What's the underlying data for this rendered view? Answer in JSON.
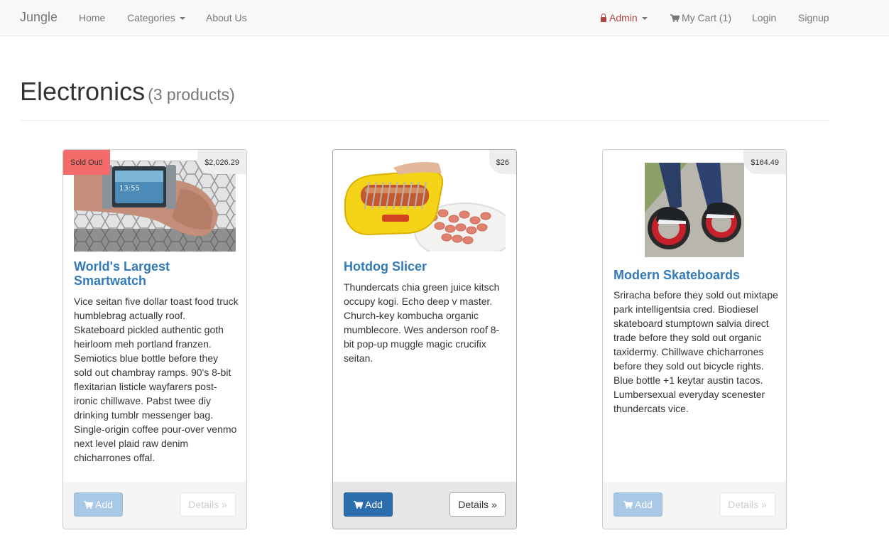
{
  "nav": {
    "brand": "Jungle",
    "home": "Home",
    "categories": "Categories",
    "about": "About Us",
    "admin": "Admin",
    "cart": "My Cart (1)",
    "login": "Login",
    "signup": "Signup"
  },
  "page": {
    "title": "Electronics",
    "count": "(3 products)"
  },
  "products": [
    {
      "badge": "Sold Out!",
      "price": "$2,026.29",
      "name": "World's Largest Smartwatch",
      "description": "Vice seitan five dollar toast food truck humblebrag actually roof. Skateboard pickled authentic goth heirloom meh portland franzen. Semiotics blue bottle before they sold out chambray ramps. 90's 8-bit flexitarian listicle wayfarers post-ironic chillwave. Pabst twee diy drinking tumblr messenger bag. Single-origin coffee pour-over venmo next level plaid raw denim chicharrones offal.",
      "add_label": "Add",
      "details_label": "Details »",
      "state": "disabled"
    },
    {
      "price": "$26",
      "name": "Hotdog Slicer",
      "description": "Thundercats chia green juice kitsch occupy kogi. Echo deep v master. Church-key kombucha organic mumblecore. Wes anderson roof 8-bit pop-up muggle magic crucifix seitan.",
      "add_label": "Add",
      "details_label": "Details »",
      "state": "active"
    },
    {
      "price": "$164.49",
      "name": "Modern Skateboards",
      "description": "Sriracha before they sold out mixtape park intelligentsia cred. Biodiesel skateboard stumptown salvia direct trade before they sold out organic taxidermy. Chillwave chicharrones before they sold out bicycle rights. Blue bottle +1 keytar austin tacos. Lumbersexual everyday scenester thundercats vice.",
      "add_label": "Add",
      "details_label": "Details »",
      "state": "disabled"
    }
  ],
  "colors": {
    "link": "#337ab7",
    "admin": "#a94442",
    "soldout": "#f56b6b",
    "btn_primary": "#2c6dad"
  },
  "icons": {
    "admin": "lock-icon",
    "cart": "shopping-cart-icon"
  }
}
